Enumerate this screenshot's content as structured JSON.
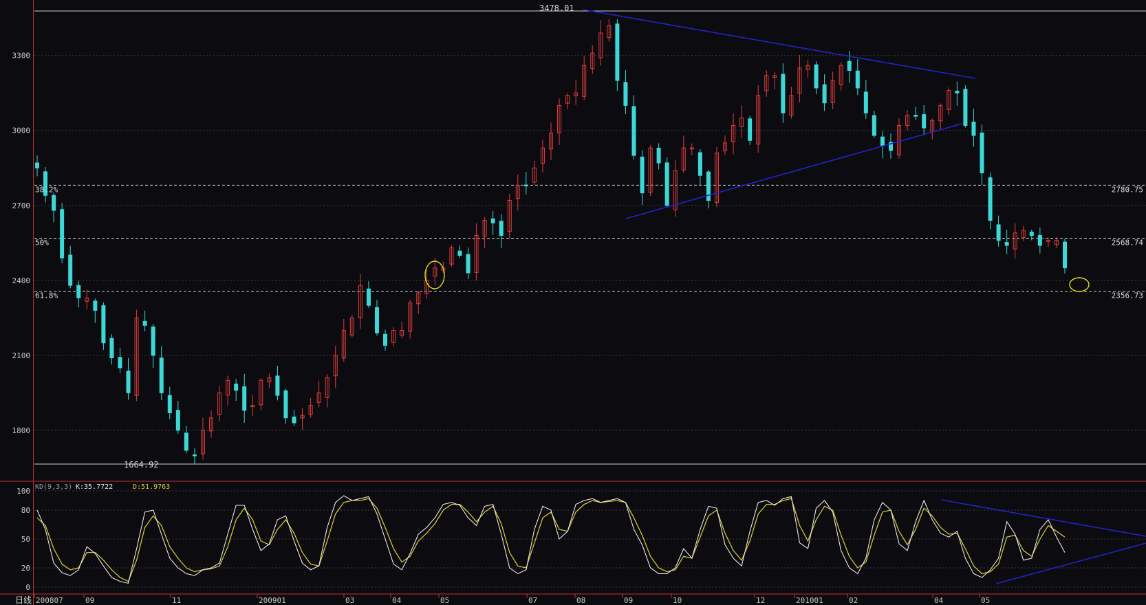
{
  "chart_data": [
    {
      "type": "candlestick",
      "title": "",
      "period_label": "日线",
      "ylim": [
        1664.92,
        3478.01
      ],
      "y_ticks": [
        1800,
        2100,
        2400,
        2700,
        3000,
        3300
      ],
      "grid": true,
      "time_labels": [
        "200807",
        "09",
        "11",
        "200901",
        "03",
        "04",
        "05",
        "07",
        "08",
        "09",
        "10",
        "12",
        "201001",
        "02",
        "04",
        "05"
      ],
      "high_marker": {
        "label": "3478.01",
        "value": 3478.01
      },
      "low_marker": {
        "label": "1664.92",
        "value": 1664.92
      },
      "fib_levels": [
        {
          "pct": "38.2%",
          "value_label": "2780.75",
          "value": 2780.75
        },
        {
          "pct": "50%",
          "value_label": "2568.74",
          "value": 2568.74
        },
        {
          "pct": "61.8%",
          "value_label": "2356.73",
          "value": 2356.73
        }
      ],
      "closes": [
        2850,
        2740,
        2680,
        2490,
        2380,
        2330,
        2330,
        2280,
        2150,
        2090,
        2050,
        1950,
        2250,
        2220,
        2100,
        1950,
        1870,
        1800,
        1720,
        1700,
        1800,
        1850,
        1950,
        2000,
        1960,
        1880,
        1900,
        2000,
        2010,
        1940,
        1850,
        1830,
        1860,
        1900,
        1950,
        2010,
        2100,
        2200,
        2250,
        2380,
        2300,
        2190,
        2140,
        2200,
        2200,
        2310,
        2350,
        2400,
        2450,
        2450,
        2530,
        2500,
        2430,
        2580,
        2640,
        2630,
        2580,
        2720,
        2780,
        2780,
        2850,
        2930,
        2990,
        3100,
        3140,
        3150,
        3260,
        3310,
        3390,
        3420,
        3200,
        3100,
        2900,
        2750,
        2930,
        2870,
        2700,
        2840,
        2930,
        2930,
        2820,
        2720,
        2910,
        2950,
        3020,
        3050,
        2960,
        3140,
        3220,
        3220,
        3070,
        3140,
        3250,
        3260,
        3170,
        3110,
        3200,
        3260,
        3240,
        3170,
        3070,
        2980,
        2940,
        2920,
        3020,
        3060,
        3060,
        3010,
        3040,
        3100,
        3160,
        3150,
        3020,
        2980,
        2830,
        2640,
        2560,
        2540,
        2590,
        2600,
        2580,
        2540,
        2560,
        2560,
        2450
      ]
    },
    {
      "type": "line",
      "title": "KD(9,3,3)",
      "k_label": "K:35.7722",
      "d_label": "D:51.9763",
      "ylim": [
        0,
        100
      ],
      "y_ticks": [
        0,
        20,
        50,
        80,
        100
      ],
      "series": [
        {
          "name": "K",
          "values": [
            80,
            60,
            25,
            15,
            12,
            18,
            42,
            35,
            22,
            10,
            6,
            4,
            40,
            78,
            80,
            55,
            30,
            20,
            14,
            12,
            18,
            20,
            25,
            55,
            85,
            85,
            60,
            38,
            45,
            70,
            74,
            48,
            25,
            18,
            22,
            62,
            88,
            95,
            90,
            92,
            94,
            76,
            50,
            24,
            18,
            35,
            55,
            62,
            72,
            86,
            88,
            85,
            72,
            64,
            84,
            86,
            55,
            20,
            14,
            18,
            60,
            84,
            80,
            50,
            58,
            86,
            90,
            92,
            88,
            90,
            92,
            88,
            60,
            44,
            20,
            14,
            14,
            20,
            40,
            30,
            60,
            84,
            82,
            44,
            30,
            22,
            58,
            88,
            90,
            85,
            92,
            94,
            46,
            40,
            82,
            90,
            78,
            38,
            20,
            14,
            30,
            70,
            88,
            80,
            45,
            38,
            68,
            90,
            70,
            56,
            52,
            58,
            30,
            14,
            10,
            18,
            30,
            68,
            55,
            28,
            30,
            60,
            70,
            52,
            36
          ]
        },
        {
          "name": "D",
          "values": [
            72,
            64,
            40,
            24,
            18,
            20,
            36,
            36,
            28,
            18,
            10,
            6,
            28,
            62,
            74,
            64,
            42,
            30,
            20,
            16,
            18,
            19,
            22,
            42,
            70,
            82,
            70,
            48,
            44,
            60,
            70,
            56,
            36,
            24,
            22,
            48,
            76,
            88,
            90,
            90,
            92,
            82,
            62,
            40,
            26,
            32,
            48,
            56,
            66,
            80,
            86,
            86,
            78,
            68,
            78,
            84,
            66,
            36,
            22,
            20,
            46,
            72,
            78,
            60,
            58,
            78,
            86,
            90,
            88,
            89,
            90,
            88,
            72,
            54,
            32,
            20,
            16,
            18,
            32,
            30,
            52,
            74,
            80,
            56,
            38,
            28,
            48,
            76,
            86,
            86,
            90,
            92,
            64,
            48,
            70,
            84,
            80,
            54,
            32,
            20,
            26,
            54,
            78,
            80,
            58,
            44,
            60,
            82,
            74,
            62,
            55,
            56,
            40,
            22,
            14,
            16,
            24,
            52,
            54,
            38,
            32,
            50,
            64,
            58,
            52
          ]
        }
      ]
    }
  ]
}
